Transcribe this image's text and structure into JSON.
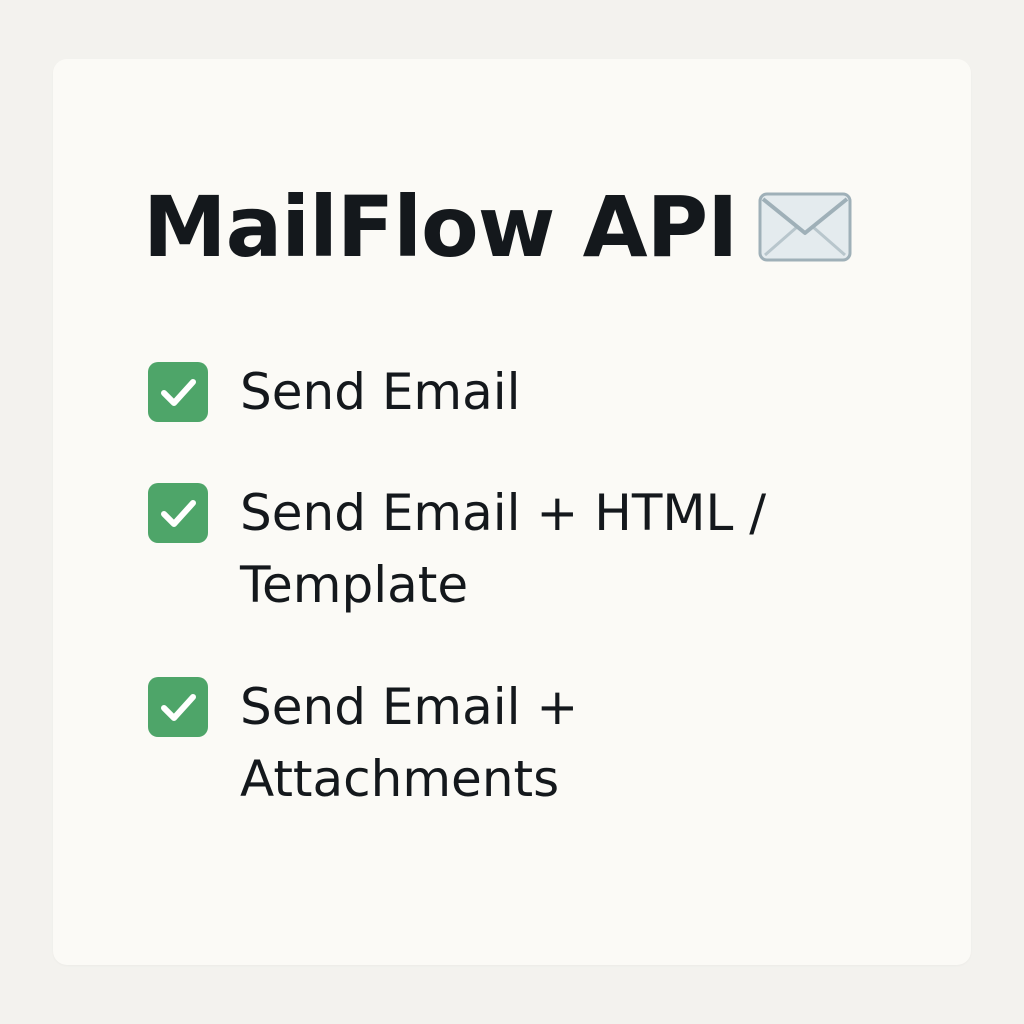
{
  "card": {
    "title": "MailFlow API",
    "title_icon": "envelope-icon"
  },
  "features": [
    {
      "label": "Send Email",
      "icon": "checkmark-icon",
      "checked": true
    },
    {
      "label": "Send Email + HTML /\nTemplate",
      "icon": "checkmark-icon",
      "checked": true
    },
    {
      "label": "Send Email +\nAttachments",
      "icon": "checkmark-icon",
      "checked": true
    }
  ],
  "colors": {
    "page_background": "#f3f2ee",
    "card_background": "#fbfaf6",
    "text": "#14181c",
    "check_green": "#4ea569",
    "check_mark": "#ffffff"
  }
}
